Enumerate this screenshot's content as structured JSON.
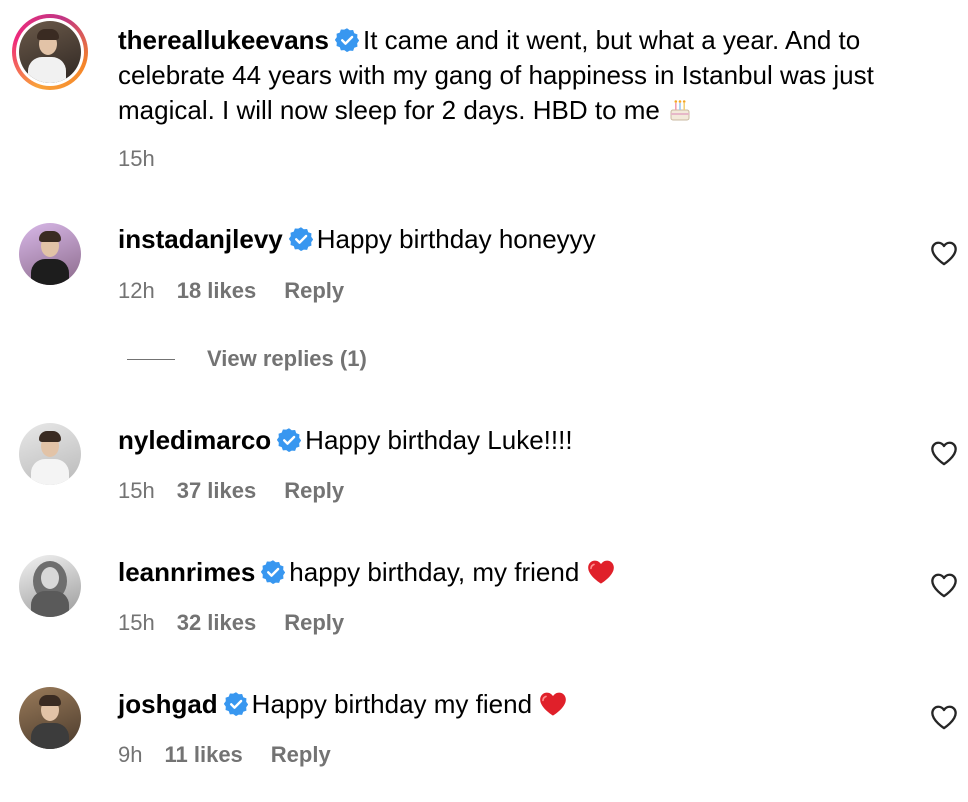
{
  "caption": {
    "username": "thereallukeevans",
    "verified": true,
    "text": "It came and it went, but what a year. And to celebrate 44 years with my gang of happiness in Istanbul was just magical. I will now sleep for 2 days. HBD to me",
    "emoji": "cake-icon",
    "time": "15h"
  },
  "comments": [
    {
      "username": "instadanjlevy",
      "verified": true,
      "text": "Happy birthday honeyyy",
      "emoji": "",
      "time": "12h",
      "likes": "18 likes",
      "reply": "Reply"
    },
    {
      "username": "nyledimarco",
      "verified": true,
      "text": "Happy birthday Luke!!!!",
      "emoji": "",
      "time": "15h",
      "likes": "37 likes",
      "reply": "Reply"
    },
    {
      "username": "leannrimes",
      "verified": true,
      "text": "happy birthday, my friend",
      "emoji": "red-heart-icon",
      "time": "15h",
      "likes": "32 likes",
      "reply": "Reply"
    },
    {
      "username": "joshgad",
      "verified": true,
      "text": "Happy birthday my fiend",
      "emoji": "red-heart-icon",
      "time": "9h",
      "likes": "11 likes",
      "reply": "Reply"
    }
  ],
  "view_replies": {
    "label": "View replies (1)"
  },
  "colors": {
    "verified_badge": "#3897f0",
    "meta_text": "#737373",
    "heart_emoji": "#e0202a"
  }
}
